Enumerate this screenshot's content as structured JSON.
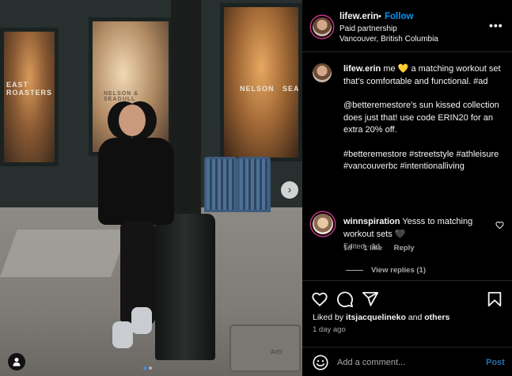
{
  "photo": {
    "window_sign_left": "EAST\nROASTERS",
    "window_sign_right": "NELSON   SEAGUL",
    "window_sign_mid": "NELSON & SEAGULL",
    "drain_label": "AVO",
    "carousel_next_icon": "chevron-right-icon",
    "slide_count": 2,
    "active_slide": 1
  },
  "header": {
    "username": "lifew.erin",
    "dot": "•",
    "follow_label": "Follow",
    "paid": "Paid partnership",
    "location": "Vancouver, British Columbia",
    "more_icon": "more-horizontal-icon",
    "more_glyph": "•••"
  },
  "caption": {
    "username": "lifew.erin",
    "line1_a": " me ",
    "line1_emoji": "💛",
    "line1_b": " a matching workout set that's comfortable and functional. #ad",
    "para2": "@betteremestore's sun kissed collection does just that! use code ERIN20 for an extra 20% off.",
    "para3": "#betteremestore #streetstyle #athleisure #vancouverbc #intentionalliving",
    "meta": "Edited · 1d"
  },
  "comment": {
    "username": "winnspiration",
    "text": " Yesss to matching workout sets 🖤",
    "age": "1d",
    "likes": "1 like",
    "reply": "Reply",
    "view_replies": "View replies (1)",
    "heart_icon": "heart-outline-icon"
  },
  "actions": {
    "like_icon": "heart-outline-icon",
    "comment_icon": "comment-bubble-icon",
    "share_icon": "paper-plane-icon",
    "save_icon": "bookmark-icon",
    "liked_prefix": "Liked by ",
    "liked_user": "itsjacquelineko",
    "liked_mid": " and ",
    "liked_others": "others",
    "date": "1 day ago"
  },
  "add_comment": {
    "placeholder": "Add a comment...",
    "post_label": "Post",
    "emoji_icon": "smiley-icon"
  },
  "colors": {
    "background": "#000000",
    "text": "#f5f5f5",
    "muted": "#a8a8a8",
    "link": "#0095f6",
    "post_disabled": "#2c6ea8"
  }
}
